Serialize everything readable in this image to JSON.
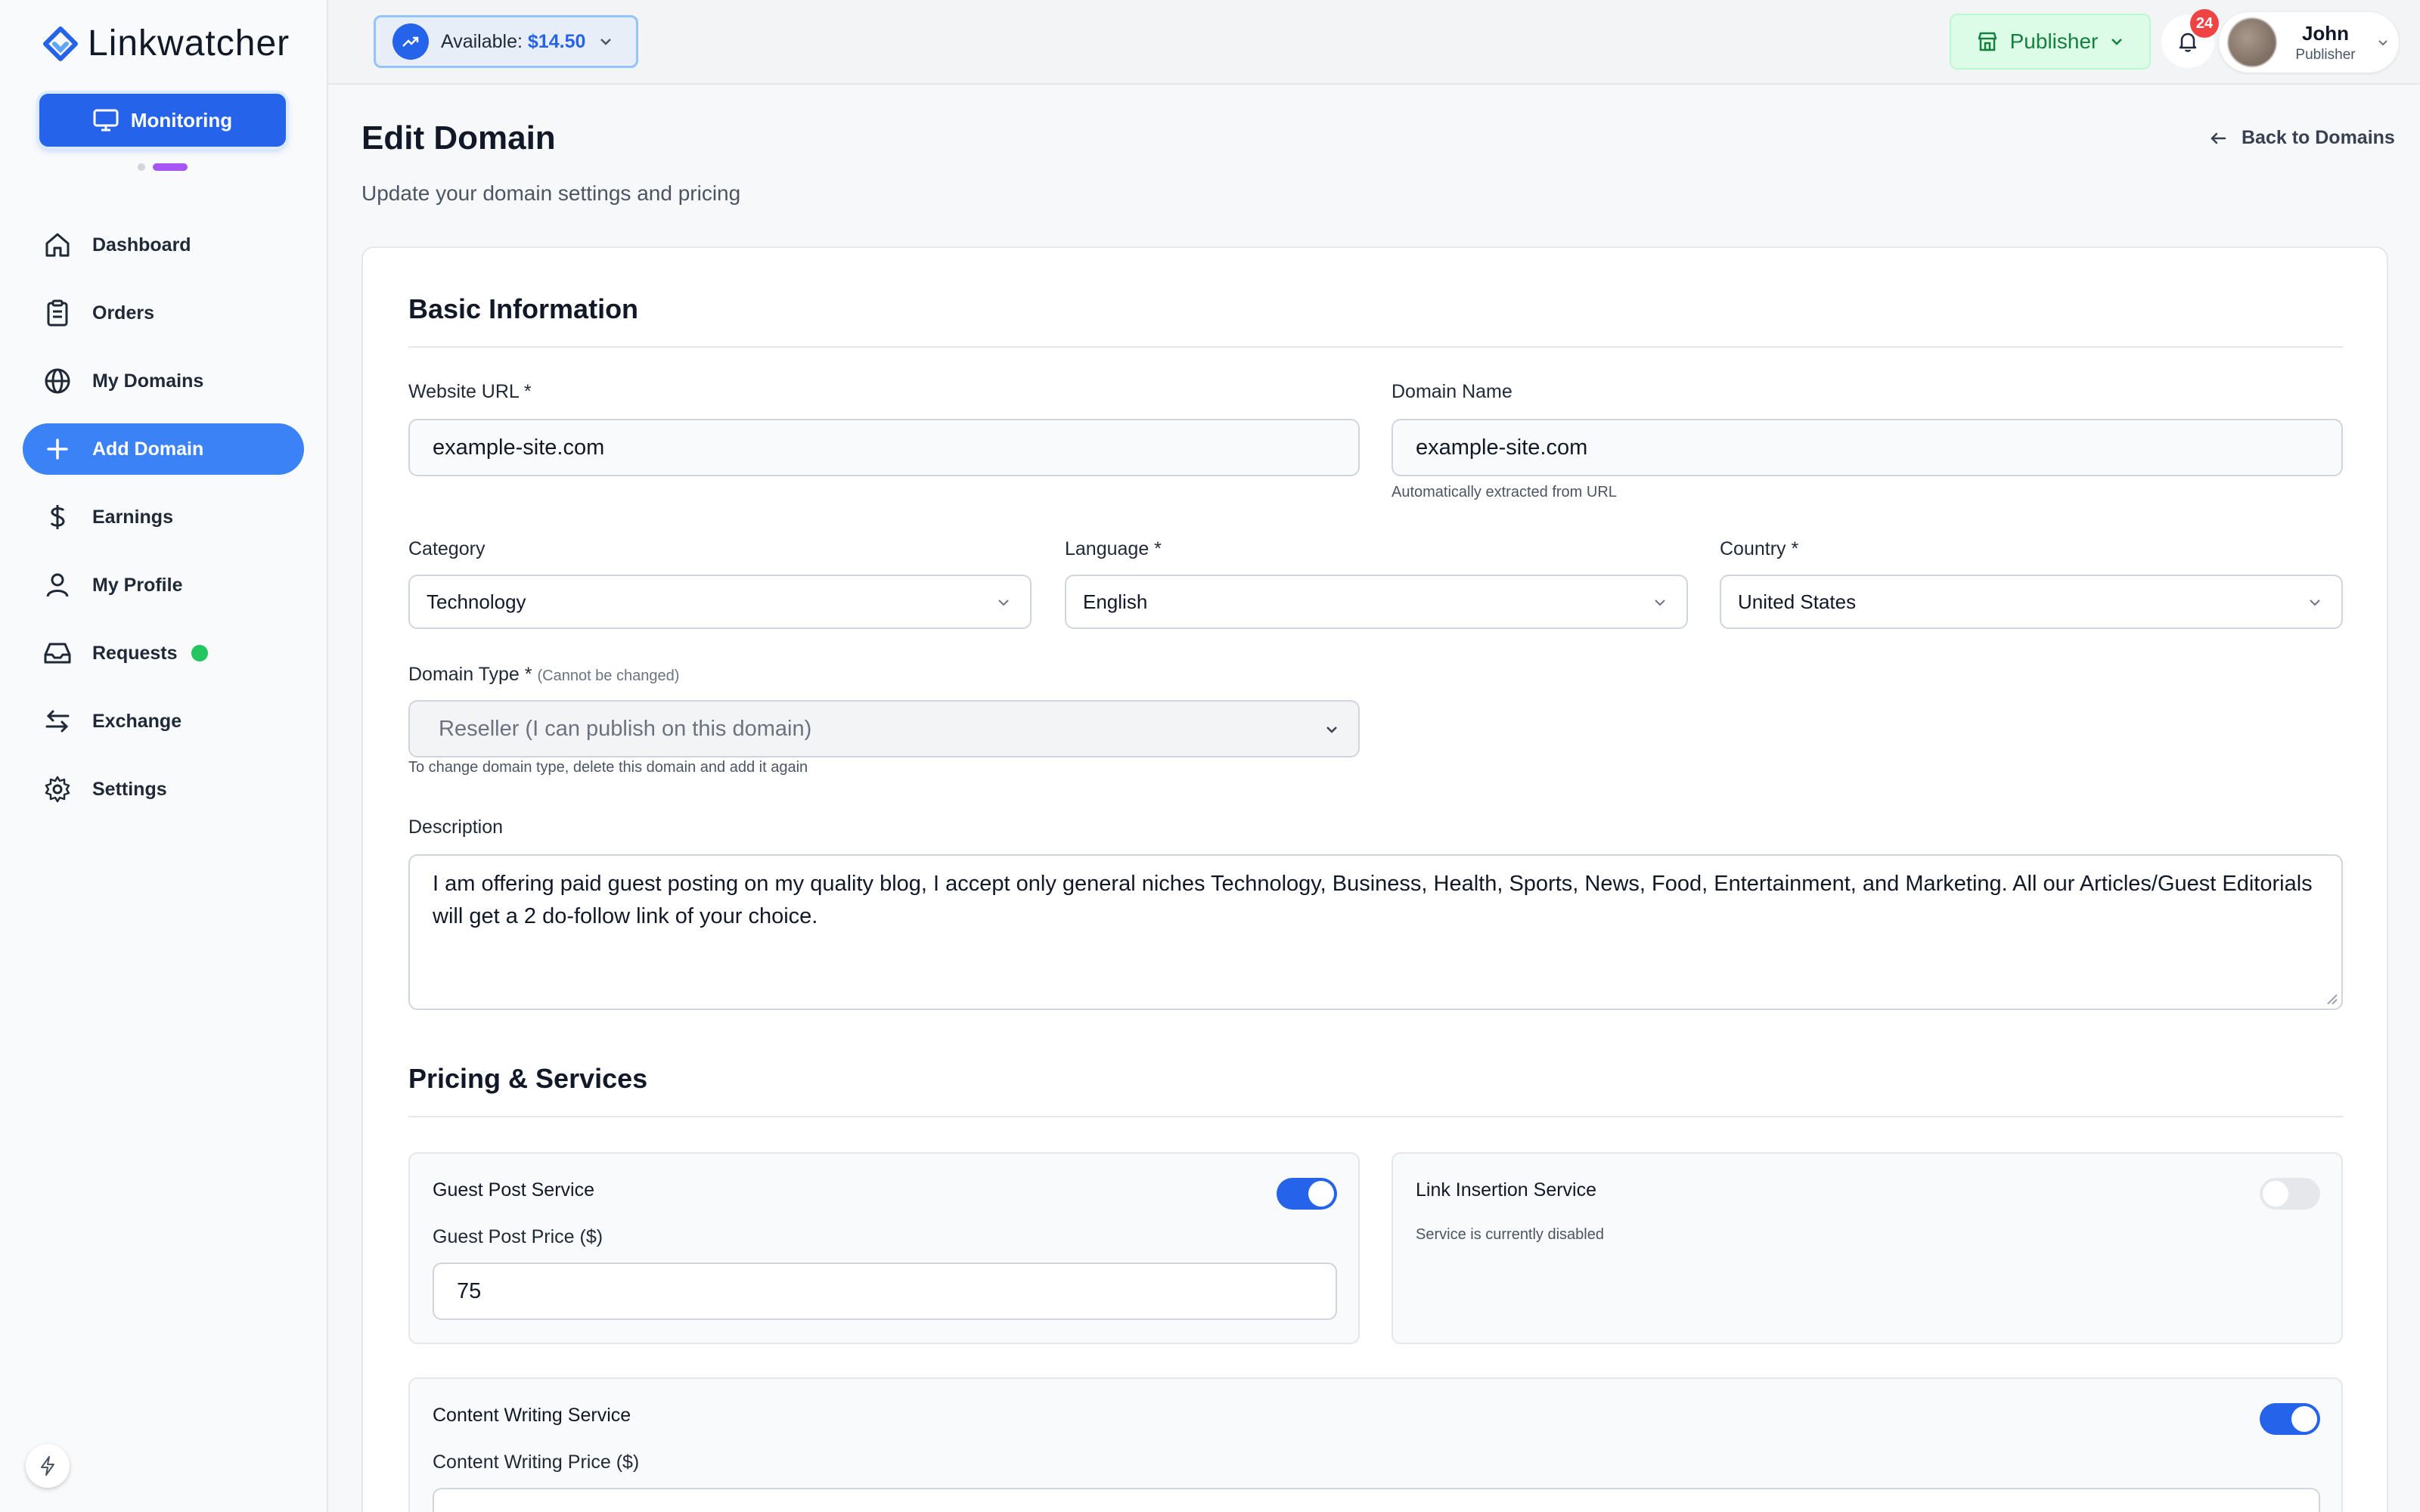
{
  "app": {
    "name": "Linkwatcher"
  },
  "sidebar": {
    "monitor_label": "Monitoring",
    "items": [
      {
        "label": "Dashboard",
        "icon": "home-icon"
      },
      {
        "label": "Orders",
        "icon": "clipboard-icon"
      },
      {
        "label": "My Domains",
        "icon": "globe-icon"
      },
      {
        "label": "Add Domain",
        "icon": "plus-icon",
        "active": true
      },
      {
        "label": "Earnings",
        "icon": "dollar-icon"
      },
      {
        "label": "My Profile",
        "icon": "user-icon"
      },
      {
        "label": "Requests",
        "icon": "inbox-icon"
      },
      {
        "label": "Exchange",
        "icon": "exchange-icon"
      },
      {
        "label": "Settings",
        "icon": "gear-icon"
      }
    ]
  },
  "header": {
    "available_label": "Available:",
    "available_amount": "$14.50",
    "role_button": "Publisher",
    "notification_count": "24",
    "user_name": "John",
    "user_role": "Publisher"
  },
  "page": {
    "title": "Edit Domain",
    "subtitle": "Update your domain settings and pricing",
    "back_link": "Back to Domains"
  },
  "basic": {
    "section_title": "Basic Information",
    "website_url_label": "Website URL *",
    "website_url_value": "example-site.com",
    "domain_name_label": "Domain Name",
    "domain_name_value": "example-site.com",
    "domain_name_hint": "Automatically extracted from URL",
    "category_label": "Category",
    "category_value": "Technology",
    "language_label": "Language *",
    "language_value": "English",
    "country_label": "Country *",
    "country_value": "United States",
    "domain_type_label": "Domain Type *",
    "domain_type_note": "(Cannot be changed)",
    "domain_type_value": "Reseller (I can publish on this domain)",
    "domain_type_hint": "To change domain type, delete this domain and add it again",
    "description_label": "Description",
    "description_value": "I am offering paid guest posting on my quality blog, I accept only general niches Technology, Business, Health, Sports, News, Food, Entertainment, and Marketing. All our Articles/Guest Editorials will get a 2 do-follow link of your choice."
  },
  "pricing": {
    "section_title": "Pricing & Services",
    "guest_post_title": "Guest Post Service",
    "guest_post_enabled": true,
    "guest_post_price_label": "Guest Post Price ($)",
    "guest_post_price": "75",
    "link_insertion_title": "Link Insertion Service",
    "link_insertion_enabled": false,
    "link_insertion_status": "Service is currently disabled",
    "content_writing_title": "Content Writing Service",
    "content_writing_enabled": true,
    "content_writing_price_label": "Content Writing Price ($)"
  },
  "colors": {
    "accent": "#2563eb",
    "publisher_bg": "#dcfce7",
    "publisher_text": "#15803d",
    "badge": "#ef4444"
  }
}
